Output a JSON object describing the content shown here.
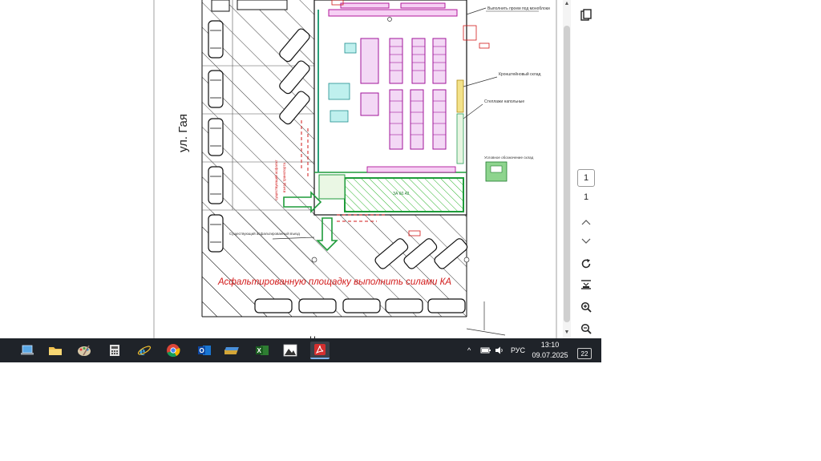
{
  "document": {
    "street_left": "ул. Гая",
    "bottom_street": "Ч",
    "asphalt_note": "Асфальтированную площадку выполнить силами КА",
    "callout_top": "Выполнить проем под моноблоки",
    "callout_shelves": "Кронштейновый склад",
    "callout_racks": "Стеллажи напольные",
    "callout_legend": "Условное обозначение склад",
    "callout_lower": "Существующий асфальтированный въезд",
    "zone_label": "ЗА 60.42"
  },
  "viewer": {
    "page_current": "1",
    "page_total": "1",
    "tools": [
      "copy-icon",
      "chevron-up-icon",
      "chevron-down-icon",
      "rotate-icon",
      "fit-page-icon",
      "zoom-in-icon",
      "zoom-out-icon"
    ]
  },
  "taskbar": {
    "apps": [
      "laptop-icon",
      "file-explorer-icon",
      "paint-icon",
      "calculator-icon",
      "internet-explorer-icon",
      "chrome-icon",
      "outlook-icon",
      "folder-stack-icon",
      "excel-icon",
      "photos-icon",
      "acrobat-icon"
    ],
    "active_app": "acrobat-icon",
    "language": "РУС",
    "time": "13:10",
    "date": "09.07.2025",
    "notification_count": "22",
    "tray_chevron": "^"
  }
}
